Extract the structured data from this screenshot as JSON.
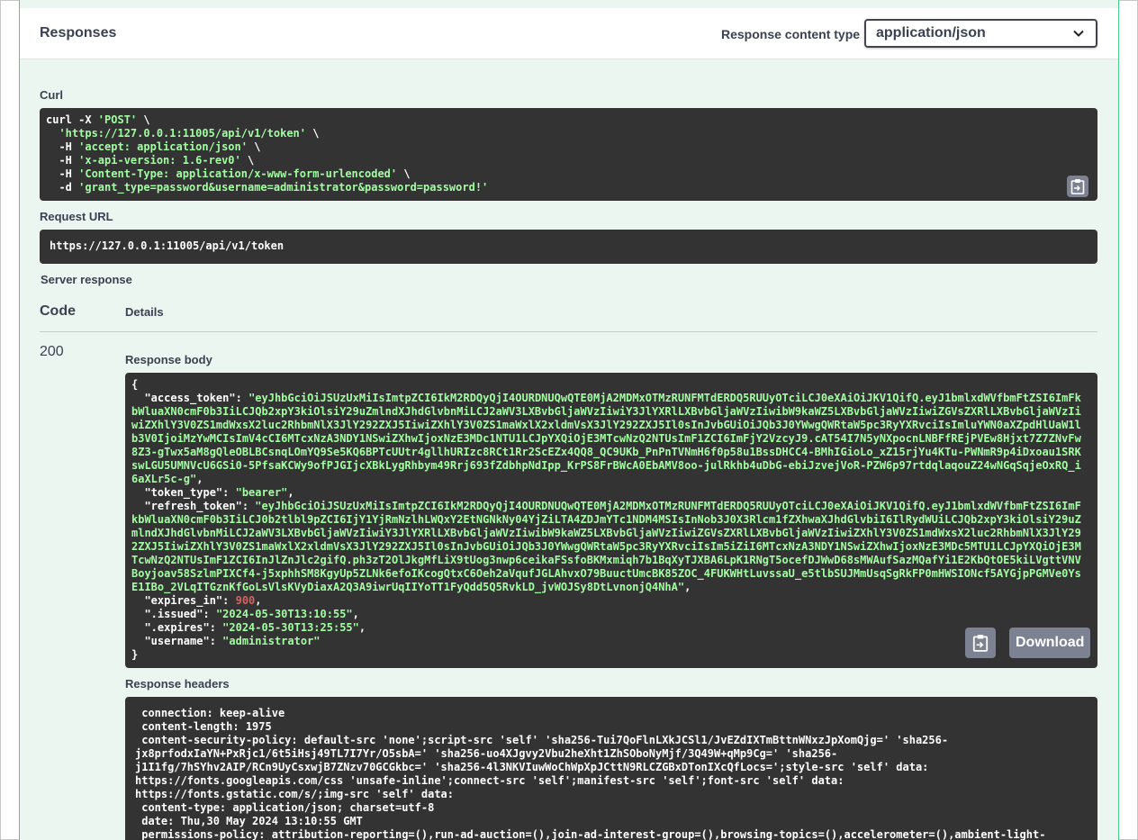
{
  "responses": {
    "title": "Responses",
    "content_type_label": "Response content type",
    "content_type_value": "application/json"
  },
  "curl": {
    "label": "Curl",
    "lines": [
      [
        "curl -X ",
        "'POST'",
        " \\"
      ],
      [
        "  ",
        "'https://127.0.0.1:11005/api/v1/token'",
        " \\"
      ],
      [
        "  -H ",
        "'accept: application/json'",
        " \\"
      ],
      [
        "  -H ",
        "'x-api-version: 1.6-rev0'",
        " \\"
      ],
      [
        "  -H ",
        "'Content-Type: application/x-www-form-urlencoded'",
        " \\"
      ],
      [
        "  -d ",
        "'grant_type=password&username=administrator&password=password!'",
        ""
      ]
    ]
  },
  "request_url": {
    "label": "Request URL",
    "value": "https://127.0.0.1:11005/api/v1/token"
  },
  "server_response": {
    "label": "Server response",
    "code_header": "Code",
    "details_header": "Details",
    "code": "200",
    "body_label": "Response body",
    "headers_label": "Response headers",
    "download_label": "Download"
  },
  "body": {
    "open": "{",
    "close": "}",
    "access_token_key": "\"access_token\"",
    "access_token_value": "\"eyJhbGciOiJSUzUxMiIsImtpZCI6IkM2RDQyQjI4OURDNUQwQTE0MjA2MDMxOTMzRUNFMTdERDQ5RUUyOTciLCJ0eXAiOiJKV1QifQ.eyJ1bmlxdWVfbmFtZSI6ImFkbWluaXN0cmF0b3IiLCJQb2xpY3kiOlsiY29uZmlndXJhdGlvbnMiLCJ2aWV3LXBvbGljaWVzIiwiY3JlYXRlLXBvbGljaWVzIiwibW9kaWZ5LXBvbGljaWVzIiwiZGVsZXRlLXBvbGljaWVzIiwiZXhlY3V0ZS1mdWxsX2luc2RhbmNlX3JlY292ZXJ5IiwiZXhlY3V0ZS1maWxlX2xldmVsX3JlY292ZXJ5Il0sInJvbGUiOiJQb3J0YWwgQWRtaW5pc3RyYXRvciIsImluYWN0aXZpdHlUaW1lb3V0IjoiMzYwMCIsImV4cCI6MTcxNzA3NDY1NSwiZXhwIjoxNzE3MDc1NTU1LCJpYXQiOjE3MTcwNzQ2NTUsImF1ZCI6ImFjY2VzcyJ9.cAT54I7N5yNXpocnLNBFfREjPVEw8Hjxt7Z7ZNvFw8Z3-gTwx5aM8gQleOBLBCsnqLOmYQ9Se5KQ6BPTcUUtr4gllhURIzc8RCt1Rr2ScEZx4QQ8_QC9UKb_PnPnTVNmH6f0p58u1BssDHCC4-BMhIGioLo_xZ15rjYu4KTu-PWNmR9p4iDxoau1SRKswLGU5UMNVcU6GSi0-5PfsaKCWy9ofPJGIjcXBkLygRhbym49Rrj693fZdbhpNdIpp_KrPS8FrBWcA0EbAMV8oo-julRkhb4uDbG-ebiJzvejVoR-PZW6p97rtdqlaqouZ24wNGqSqjeOxRQ_i6aXLr5c-g\"",
    "token_type_key": "\"token_type\"",
    "token_type_value": "\"bearer\"",
    "refresh_token_key": "\"refresh_token\"",
    "refresh_token_value": "\"eyJhbGciOiJSUzUxMiIsImtpZCI6IkM2RDQyQjI4OURDNUQwQTE0MjA2MDMxOTMzRUNFMTdERDQ5RUUyOTciLCJ0eXAiOiJKV1QifQ.eyJ1bmlxdWVfbmFtZSI6ImFkbWluaXN0cmF0b3IiLCJ0b2tlbl9pZCI6IjY1YjRmNzlhLWQxY2EtNGNkNy04YjZiLTA4ZDJmYTc1NDM4MSIsInNob3J0X3Rlcm1fZXhwaXJhdGlvbiI6IlRydWUiLCJQb2xpY3kiOlsiY29uZmlndXJhdGlvbnMiLCJ2aWV3LXBvbGljaWVzIiwiY3JlYXRlLXBvbGljaWVzIiwibW9kaWZ5LXBvbGljaWVzIiwiZGVsZXRlLXBvbGljaWVzIiwiZXhlY3V0ZS1mdWxsX2luc2RhbmNlX3JlY292ZXJ5IiwiZXhlY3V0ZS1maWxlX2xldmVsX3JlY292ZXJ5Il0sInJvbGUiOiJQb3J0YWwgQWRtaW5pc3RyYXRvciIsIm5iZiI6MTcxNzA3NDY1NSwiZXhwIjoxNzE3MDc5MTU1LCJpYXQiOjE3MTcwNzQ2NTUsImF1ZCI6InJlZnJlc2gifQ.ph3zT2OlJkgMfLiX9tUog3nwp6ceikaFSsfoBKMxmiqh7b1BqXyTJXBA6LpK1RNgT5ocefDJWwD68sMWAufSazMQafYi1E2KbQtOE5kiLVgttVNVBoyjoav58SzlmPIXCf4-j5xphhSM8KgyUp5ZLNk6efoIKcogQtxC6Oeh2aVqufJGLAhvxO79BuuctUmcBK85ZOC_4FUKWHtLuvssaU_e5tlbSUJMmUsqSgRkFP0mHWSIONcf5AYGjpPGMVe0YsE1IBo_2VLqITGznKfGoLsVlsKVyDiaxA2Q3A9iwrUqIIYoTT1FyQdd5Q5RvkLD_jvWOJSy8DtLvnonjQ4NhA\"",
    "expires_in_key": "\"expires_in\"",
    "expires_in_value": "900",
    "issued_key": "\".issued\"",
    "issued_value": "\"2024-05-30T13:10:55\"",
    "expires_key": "\".expires\"",
    "expires_value": "\"2024-05-30T13:25:55\"",
    "username_key": "\"username\"",
    "username_value": "\"administrator\""
  },
  "headers": [
    " connection: keep-alive",
    " content-length: 1975",
    " content-security-policy: default-src 'none';script-src 'self' 'sha256-Tui7QoFlnLXkJCSl1/JvEZdIXTmBttnWNxzJpXomQjg=' 'sha256-",
    "jx8prfodxIaYN+PxRjc1/6t5iHsj49TL7I7Yr/O5sbA=' 'sha256-uo4XJgvy2Vbu2heXht1ZhSOboNyMjf/3Q49W+qMp9Cg=' 'sha256-",
    "j1I1fg/7hSYhv2AIP/RCn9UyCsxwjB7ZNzv70GCGkbc=' 'sha256-4l3NKVIuwWoChWpXpJCttN9RLCZGBxDTonIXcQfLocs=';style-src 'self' data:",
    "https://fonts.googleapis.com/css 'unsafe-inline';connect-src 'self';manifest-src 'self';font-src 'self' data:",
    "https://fonts.gstatic.com/s/;img-src 'self' data:",
    " content-type: application/json; charset=utf-8",
    " date: Thu,30 May 2024 13:10:55 GMT",
    " permissions-policy: attribution-reporting=(),run-ad-auction=(),join-ad-interest-group=(),browsing-topics=(),accelerometer=(),ambient-light-"
  ]
}
